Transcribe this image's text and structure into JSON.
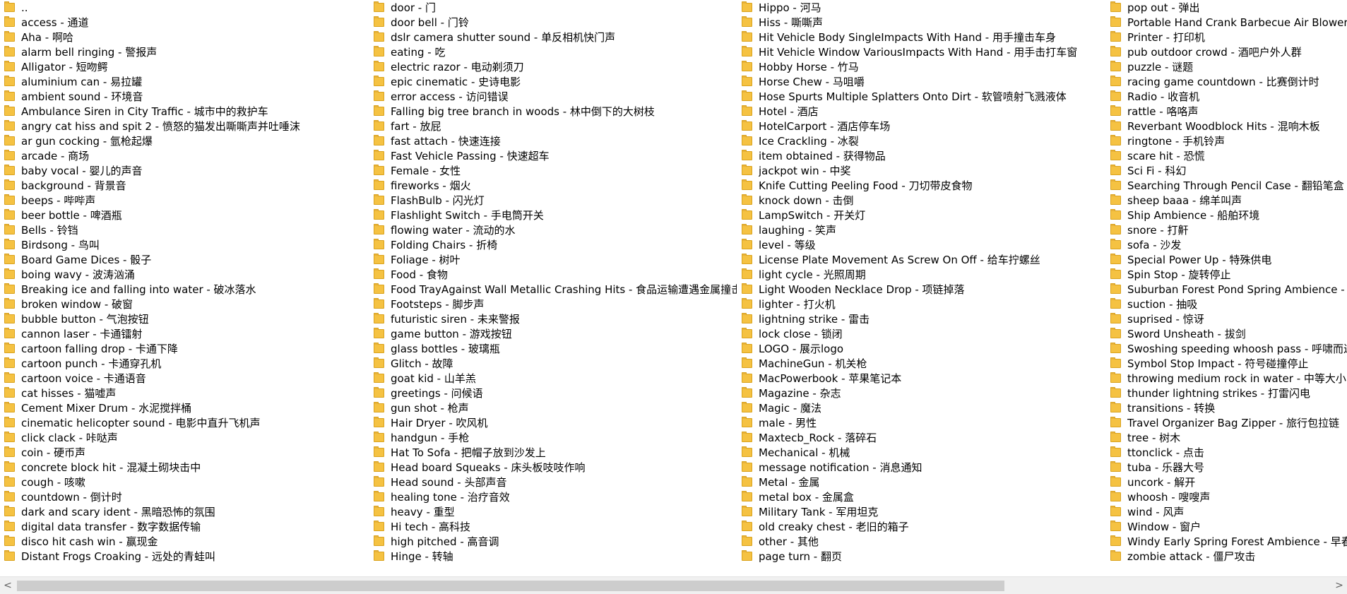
{
  "columns": [
    [
      "..",
      "access - 通道",
      "Aha - 啊哈",
      "alarm bell ringing - 警报声",
      "Alligator - 短吻鳄",
      "aluminium can - 易拉罐",
      "ambient sound - 环境音",
      "Ambulance Siren in City Traffic - 城市中的救护车",
      "angry cat hiss and spit 2 - 愤怒的猫发出嘶嘶声并吐唾沫",
      "ar gun cocking - 氩枪起爆",
      "arcade - 商场",
      "baby vocal - 婴儿的声音",
      "background - 背景音",
      "beeps - 哔哔声",
      "beer bottle - 啤酒瓶",
      "Bells - 铃铛",
      "Birdsong - 鸟叫",
      "Board Game Dices - 骰子",
      "boing wavy - 波涛汹涌",
      "Breaking ice and falling into water - 破冰落水",
      "broken window - 破窗",
      "bubble button - 气泡按钮",
      "cannon laser - 卡通镭射",
      "cartoon falling drop - 卡通下降",
      "cartoon punch - 卡通穿孔机",
      "cartoon voice - 卡通语音",
      "cat hisses - 猫嘘声",
      "Cement Mixer Drum - 水泥搅拌桶",
      "cinematic helicopter sound - 电影中直升飞机声",
      "click clack - 咔哒声",
      "coin - 硬币声",
      "concrete block hit - 混凝土砌块击中",
      "cough - 咳嗽",
      "countdown - 倒计时",
      "dark and scary ident - 黑暗恐怖的氛围",
      "digital data transfer - 数字数据传输",
      "disco hit cash win - 赢现金",
      "Distant Frogs Croaking - 远处的青蛙叫"
    ],
    [
      "door - 门",
      "door bell - 门铃",
      "dslr camera shutter sound - 单反相机快门声",
      "eating - 吃",
      "electric razor - 电动剃须刀",
      "epic cinematic - 史诗电影",
      "error access - 访问错误",
      "Falling big tree branch in woods - 林中倒下的大树枝",
      "fart - 放屁",
      "fast attach - 快速连接",
      "Fast Vehicle Passing - 快速超车",
      "Female - 女性",
      "fireworks - 烟火",
      "FlashBulb - 闪光灯",
      "Flashlight Switch - 手电筒开关",
      "flowing water - 流动的水",
      "Folding Chairs - 折椅",
      "Foliage - 树叶",
      "Food - 食物",
      "Food TrayAgainst Wall Metallic Crashing Hits - 食品运输遭遇金属撞击",
      "Footsteps - 脚步声",
      "futuristic siren - 未来警报",
      "game button - 游戏按钮",
      "glass bottles - 玻璃瓶",
      "Glitch - 故障",
      "goat kid - 山羊羔",
      "greetings - 问候语",
      "gun shot - 枪声",
      "Hair Dryer - 吹风机",
      "handgun - 手枪",
      "Hat To Sofa - 把帽子放到沙发上",
      "Head board Squeaks - 床头板吱吱作响",
      "Head sound - 头部声音",
      "healing tone - 治疗音效",
      "heavy - 重型",
      "Hi tech - 高科技",
      "high pitched - 高音调",
      "Hinge - 转轴"
    ],
    [
      "Hippo - 河马",
      "Hiss - 嘶嘶声",
      "Hit Vehicle Body SingleImpacts With Hand - 用手撞击车身",
      "Hit Vehicle Window VariousImpacts With Hand - 用手击打车窗",
      "Hobby Horse - 竹马",
      "Horse Chew - 马咀嚼",
      "Hose Spurts Multiple Splatters Onto Dirt - 软管喷射飞溅液体",
      "Hotel - 酒店",
      "HotelCarport - 酒店停车场",
      "Ice Crackling - 冰裂",
      "item obtained - 获得物品",
      "jackpot win - 中奖",
      "Knife Cutting Peeling Food - 刀切带皮食物",
      "knock down - 击倒",
      "LampSwitch - 开关灯",
      "laughing - 笑声",
      "level - 等级",
      "License Plate Movement As Screw On Off - 给车拧螺丝",
      "light cycle - 光照周期",
      "Light Wooden Necklace Drop - 项链掉落",
      "lighter - 打火机",
      "lightning strike - 雷击",
      "lock close - 锁闭",
      "LOGO - 展示logo",
      "MachineGun - 机关枪",
      "MacPowerbook - 苹果笔记本",
      "Magazine - 杂志",
      "Magic - 魔法",
      "male - 男性",
      "Maxtecb_Rock - 落碎石",
      "Mechanical - 机械",
      "message notification - 消息通知",
      "Metal - 金属",
      "metal box - 金属盒",
      "Military Tank - 军用坦克",
      "old creaky chest - 老旧的箱子",
      "other - 其他",
      "page turn - 翻页"
    ],
    [
      "pop out - 弹出",
      "Portable Hand Crank Barbecue Air Blower - 便",
      "Printer - 打印机",
      "pub outdoor crowd - 酒吧户外人群",
      "puzzle - 谜题",
      "racing game countdown - 比赛倒计时",
      "Radio - 收音机",
      "rattle - 咯咯声",
      "Reverbant Woodblock Hits - 混响木板",
      "ringtone - 手机铃声",
      "scare hit - 恐慌",
      "Sci Fi - 科幻",
      "Searching Through Pencil Case - 翻铅笔盒",
      "sheep baaa - 绵羊叫声",
      "Ship Ambience - 船舶环境",
      "snore - 打鼾",
      "sofa - 沙发",
      "Special Power Up - 特殊供电",
      "Spin Stop - 旋转停止",
      "Suburban Forest Pond Spring Ambience - 郊",
      "suction - 抽吸",
      "suprised - 惊讶",
      "Sword Unsheath - 拔剑",
      "Swoshing speeding whoosh pass - 呼啸而过",
      "Symbol Stop Impact - 符号碰撞停止",
      "throwing medium rock in water - 中等大小的石",
      "thunder lightning strikes - 打雷闪电",
      "transitions - 转换",
      "Travel Organizer Bag Zipper - 旅行包拉链",
      "tree - 树木",
      "ttonclick - 点击",
      "tuba - 乐器大号",
      "uncork - 解开",
      "whoosh - 嗖嗖声",
      "wind - 风声",
      "Window - 窗户",
      "Windy Early Spring Forest Ambience - 早春有",
      "zombie attack - 僵尸攻击"
    ]
  ],
  "icon": "folder-icon",
  "folder_color": "#f5c242",
  "scrollbar": {
    "left_arrow": "<",
    "right_arrow": ">"
  }
}
